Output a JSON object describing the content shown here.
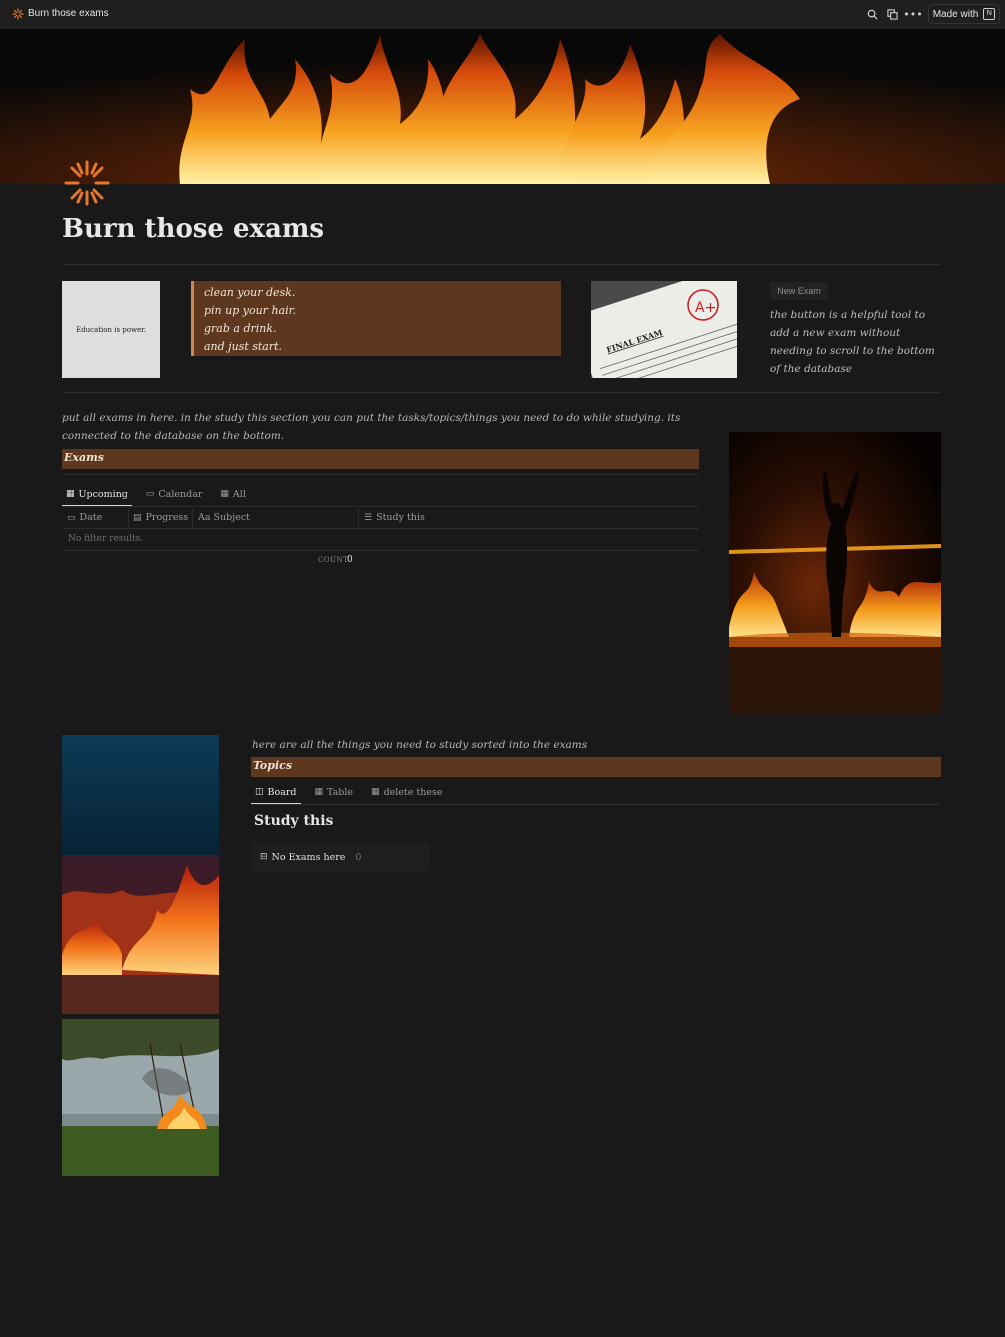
{
  "topbar": {
    "page_title": "Burn those exams",
    "made_with_label": "Made with",
    "icons": [
      "search-icon",
      "duplicate-icon",
      "more-icon",
      "notion-logo-icon"
    ]
  },
  "page": {
    "title": "Burn those exams",
    "icon": "sunburst-icon"
  },
  "row1": {
    "edu_card_text": "Education is power.",
    "quote_lines": [
      "clean your desk.",
      "pin up your hair.",
      "grab a drink.",
      "and just start."
    ],
    "exam_photo_texts": [
      "FINAL EXAM",
      "A+"
    ],
    "new_exam_button": "New Exam",
    "button_note": "the button is a helpful tool to add a new exam without needing to scroll to the bottom of the database"
  },
  "exams": {
    "note": "put all exams in here. in the study this section you can put the tasks/topics/things you need to do while studying. its connected to the database on the bottom.",
    "header": "Exams",
    "tabs": [
      {
        "label": "Upcoming",
        "icon": "table-icon",
        "active": true
      },
      {
        "label": "Calendar",
        "icon": "calendar-icon",
        "active": false
      },
      {
        "label": "All",
        "icon": "table-icon",
        "active": false
      }
    ],
    "columns": [
      {
        "label": "Date",
        "icon": "calendar-icon"
      },
      {
        "label": "Progress",
        "icon": "formula-icon"
      },
      {
        "label": "Aa Subject",
        "icon": ""
      },
      {
        "label": "Study this",
        "icon": "list-icon"
      }
    ],
    "empty_text": "No filter results.",
    "count_label": "COUNT",
    "count_value": "0"
  },
  "topics": {
    "note": "here are all the things you need to study sorted into the exams",
    "header": "Topics",
    "tabs": [
      {
        "label": "Board",
        "icon": "board-icon",
        "active": true
      },
      {
        "label": "Table",
        "icon": "table-icon",
        "active": false
      },
      {
        "label": "delete these",
        "icon": "table-icon",
        "active": false
      }
    ],
    "group_title": "Study this",
    "group_card_label": "No Exams here",
    "group_card_count": "0"
  },
  "colors": {
    "background": "#191919",
    "accent_brown": "#5d381e",
    "accent_orange": "#e8772e"
  }
}
